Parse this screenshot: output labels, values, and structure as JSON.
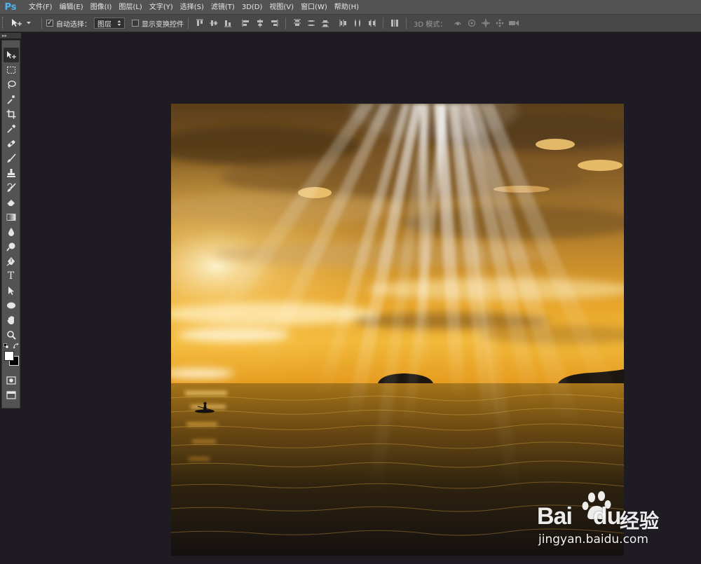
{
  "app": {
    "logo": "Ps"
  },
  "menu": {
    "items": [
      {
        "label": "文件(F)"
      },
      {
        "label": "编辑(E)"
      },
      {
        "label": "图像(I)"
      },
      {
        "label": "图层(L)"
      },
      {
        "label": "文字(Y)"
      },
      {
        "label": "选择(S)"
      },
      {
        "label": "滤镜(T)"
      },
      {
        "label": "3D(D)"
      },
      {
        "label": "视图(V)"
      },
      {
        "label": "窗口(W)"
      },
      {
        "label": "帮助(H)"
      }
    ]
  },
  "options": {
    "auto_select_label": "自动选择：",
    "auto_select_checked": true,
    "auto_select_target": "图层",
    "show_transform_label": "显示变换控件",
    "show_transform_checked": false,
    "mode_3d_label": "3D 模式："
  },
  "toolbar": {
    "tools": [
      {
        "icon": "move-icon",
        "active": true
      },
      {
        "icon": "marquee-icon"
      },
      {
        "icon": "lasso-icon"
      },
      {
        "icon": "magic-wand-icon"
      },
      {
        "icon": "crop-icon"
      },
      {
        "icon": "eyedropper-icon"
      },
      {
        "icon": "healing-brush-icon"
      },
      {
        "icon": "brush-icon"
      },
      {
        "icon": "clone-stamp-icon"
      },
      {
        "icon": "history-brush-icon"
      },
      {
        "icon": "eraser-icon"
      },
      {
        "icon": "gradient-icon"
      },
      {
        "icon": "blur-icon"
      },
      {
        "icon": "dodge-icon"
      },
      {
        "icon": "pen-icon"
      },
      {
        "icon": "type-icon"
      },
      {
        "icon": "path-selection-icon"
      },
      {
        "icon": "ellipse-icon"
      },
      {
        "icon": "hand-icon"
      },
      {
        "icon": "zoom-icon"
      }
    ],
    "foreground_color": "#ffffff",
    "background_color": "#000000",
    "type_tool_glyph": "T"
  },
  "watermark": {
    "brand": "Bai",
    "brand_tail": "du",
    "cn": "经验",
    "url": "jingyan.baidu.com"
  },
  "colors": {
    "menubar": "#535353",
    "optbar": "#484848",
    "workspace": "#1e1c22",
    "ps_blue": "#4fb4f0"
  }
}
